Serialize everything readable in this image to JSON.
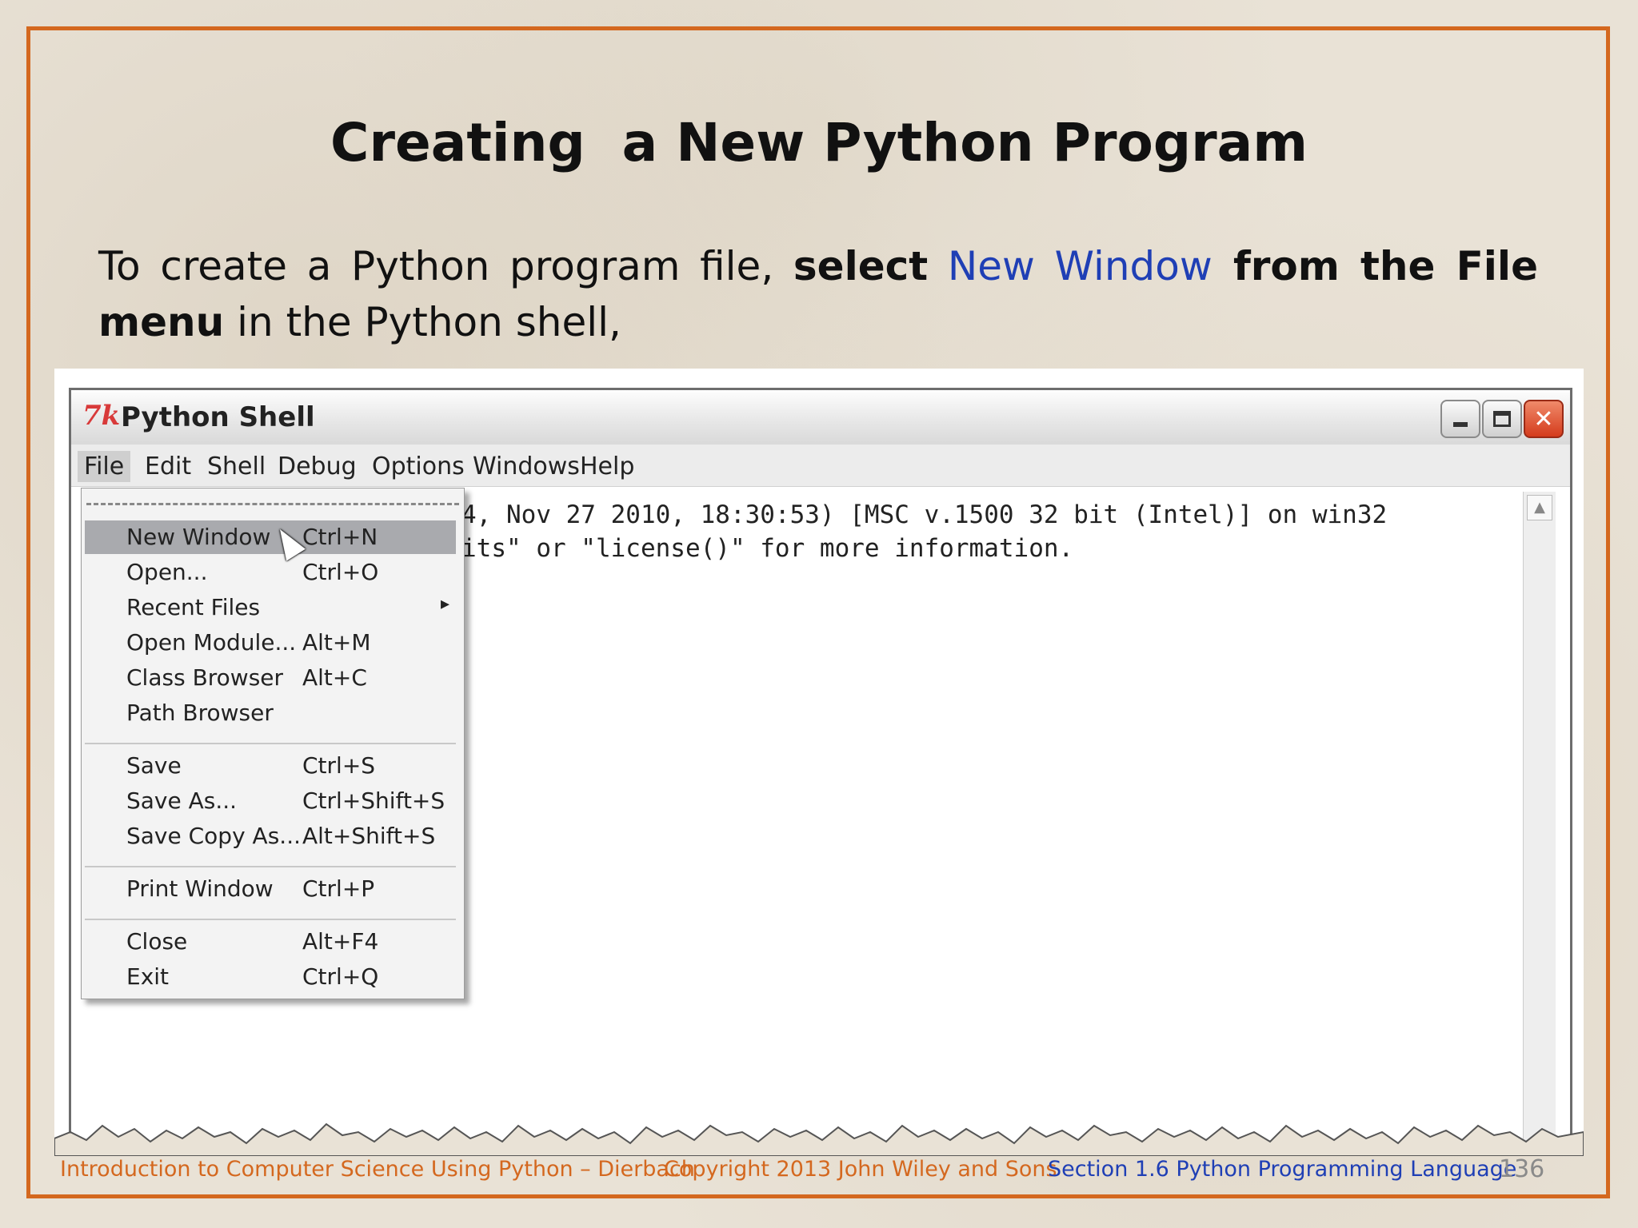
{
  "slide": {
    "title": "Creating  a New Python Program",
    "body": {
      "part1": "To create a Python program file, ",
      "bold1": "select",
      "space": " ",
      "link": "New Window",
      "bold2": " from the File menu",
      "part2": " in the Python shell,"
    },
    "footer": {
      "book": "Introduction to Computer Science Using Python – Dierbach",
      "copyright": "Copyright 2013 John Wiley and  Sons",
      "section": "Section 1.6  Python Programming Language",
      "page": "136"
    },
    "frame_color": "#d4681f"
  },
  "window": {
    "logo": "7k",
    "title": "Python Shell",
    "controls": [
      "minimize-icon",
      "maximize-icon",
      "close-icon"
    ],
    "close_glyph": "✕"
  },
  "menubar": {
    "items": [
      "File",
      "Edit",
      "Shell",
      "Debug",
      "Options",
      "Windows",
      "Help"
    ],
    "active": "File"
  },
  "editor": {
    "lines": [
      "4, Nov 27 2010, 18:30:53) [MSC v.1500 32 bit (Intel)] on win32",
      "its\" or \"license()\" for more information."
    ],
    "scroll_up_glyph": "▲"
  },
  "file_menu": {
    "items": [
      {
        "label": "New Window",
        "shortcut": "Ctrl+N",
        "highlighted": true
      },
      {
        "label": "Open...",
        "shortcut": "Ctrl+O"
      },
      {
        "label": "Recent Files",
        "shortcut": "",
        "submenu": "▸"
      },
      {
        "label": "Open Module...",
        "shortcut": "Alt+M"
      },
      {
        "label": "Class Browser",
        "shortcut": "Alt+C"
      },
      {
        "label": "Path Browser",
        "shortcut": ""
      },
      {
        "label": "Save",
        "shortcut": "Ctrl+S"
      },
      {
        "label": "Save As...",
        "shortcut": "Ctrl+Shift+S"
      },
      {
        "label": "Save Copy As...",
        "shortcut": "Alt+Shift+S"
      },
      {
        "label": "Print Window",
        "shortcut": "Ctrl+P"
      },
      {
        "label": "Close",
        "shortcut": "Alt+F4"
      },
      {
        "label": "Exit",
        "shortcut": "Ctrl+Q"
      }
    ]
  }
}
